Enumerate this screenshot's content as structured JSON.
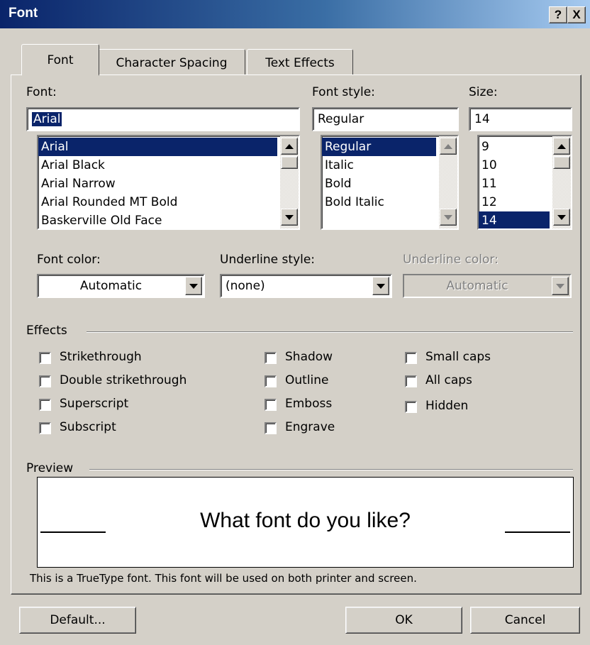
{
  "window": {
    "title": "Font",
    "help_label": "?",
    "close_label": "X"
  },
  "tabs": [
    {
      "label": "Font",
      "active": true
    },
    {
      "label": "Character Spacing",
      "active": false
    },
    {
      "label": "Text Effects",
      "active": false
    }
  ],
  "font": {
    "label": "Font:",
    "value": "Arial",
    "items": [
      "Arial",
      "Arial Black",
      "Arial Narrow",
      "Arial Rounded MT Bold",
      "Baskerville Old Face"
    ],
    "selected": "Arial"
  },
  "style": {
    "label": "Font style:",
    "value": "Regular",
    "items": [
      "Regular",
      "Italic",
      "Bold",
      "Bold Italic"
    ],
    "selected": "Regular"
  },
  "size": {
    "label": "Size:",
    "value": "14",
    "items": [
      "9",
      "10",
      "11",
      "12",
      "14"
    ],
    "selected": "14"
  },
  "font_color": {
    "label": "Font color:",
    "value": "Automatic"
  },
  "underline_style": {
    "label": "Underline style:",
    "value": "(none)"
  },
  "underline_color": {
    "label": "Underline color:",
    "value": "Automatic",
    "disabled": true
  },
  "effects": {
    "label": "Effects",
    "col1": [
      "Strikethrough",
      "Double strikethrough",
      "Superscript",
      "Subscript"
    ],
    "col2": [
      "Shadow",
      "Outline",
      "Emboss",
      "Engrave"
    ],
    "col3": [
      "Small caps",
      "All caps",
      "Hidden"
    ]
  },
  "preview": {
    "label": "Preview",
    "sample": "What font do you like?",
    "note": "This is a TrueType font. This font will be used on both printer and screen."
  },
  "buttons": {
    "default": "Default...",
    "ok": "OK",
    "cancel": "Cancel"
  },
  "colors": {
    "title_start": "#0a246a",
    "title_end": "#a6caf0",
    "face": "#d4d0c8",
    "selection": "#0a246a"
  }
}
